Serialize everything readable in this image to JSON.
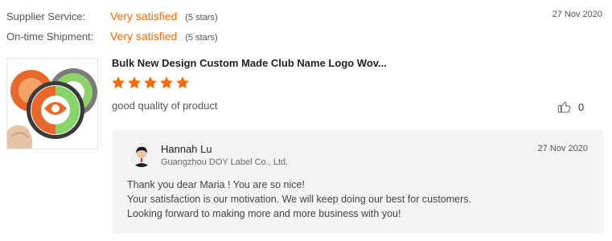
{
  "ratings": [
    {
      "label": "Supplier Service:",
      "value": "Very satisfied",
      "stars_note": "(5 stars)"
    },
    {
      "label": "On-time Shipment:",
      "value": "Very satisfied",
      "stars_note": "(5 stars)"
    }
  ],
  "review": {
    "date": "27 Nov 2020",
    "product_title": "Bulk New Design Custom Made Club Name Logo Wov...",
    "rating_stars": 5,
    "text": "good quality of product",
    "likes": "0"
  },
  "reply": {
    "name": "Hannah Lu",
    "company": "Guangzhou DOY Label Co., Ltd.",
    "date": "27 Nov 2020",
    "lines": [
      "Thank you dear Maria ! You are so nice!",
      "Your satisfaction is our motivation. We will keep doing our best for customers.",
      "Looking forward to making more and more business with you!"
    ]
  },
  "colors": {
    "accent": "#ff6a00",
    "reply_bg": "#f4f4f4"
  },
  "icons": {
    "star": "star-icon",
    "like": "thumbs-up-icon"
  }
}
